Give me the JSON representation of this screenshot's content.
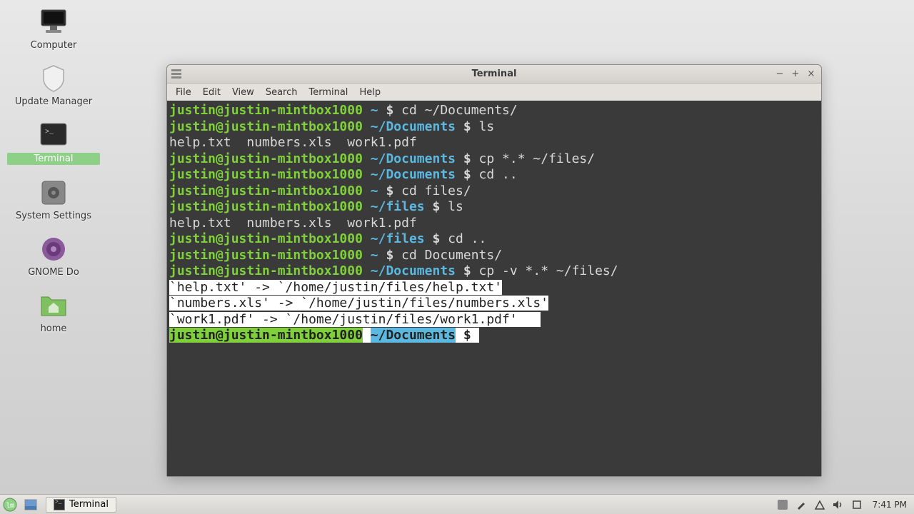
{
  "desktop_icons": [
    {
      "name": "computer",
      "label": "Computer"
    },
    {
      "name": "update-manager",
      "label": "Update Manager"
    },
    {
      "name": "terminal",
      "label": "Terminal",
      "active": true
    },
    {
      "name": "system-settings",
      "label": "System Settings"
    },
    {
      "name": "gnome-do",
      "label": "GNOME Do"
    },
    {
      "name": "home",
      "label": "home"
    }
  ],
  "window": {
    "title": "Terminal",
    "menu": [
      "File",
      "Edit",
      "View",
      "Search",
      "Terminal",
      "Help"
    ]
  },
  "terminal": {
    "user_host": "justin@justin-mintbox1000",
    "lines": [
      {
        "path": "~",
        "cmd": "cd ~/Documents/"
      },
      {
        "path": "~/Documents",
        "cmd": "ls"
      },
      {
        "out": "help.txt  numbers.xls  work1.pdf"
      },
      {
        "path": "~/Documents",
        "cmd": "cp *.* ~/files/"
      },
      {
        "path": "~/Documents",
        "cmd": "cd .."
      },
      {
        "path": "~",
        "cmd": "cd files/"
      },
      {
        "path": "~/files",
        "cmd": "ls"
      },
      {
        "out": "help.txt  numbers.xls  work1.pdf"
      },
      {
        "path": "~/files",
        "cmd": "cd .."
      },
      {
        "path": "~",
        "cmd": "cd Documents/"
      },
      {
        "path": "~/Documents",
        "cmd": "cp -v *.* ~/files/"
      }
    ],
    "selected_output": [
      "`help.txt' -> `/home/justin/files/help.txt'",
      "`numbers.xls' -> `/home/justin/files/numbers.xls'",
      "`work1.pdf' -> `/home/justin/files/work1.pdf'"
    ],
    "prompt_path": "~/Documents"
  },
  "taskbar": {
    "task_label": "Terminal",
    "clock": "7:41 PM"
  }
}
